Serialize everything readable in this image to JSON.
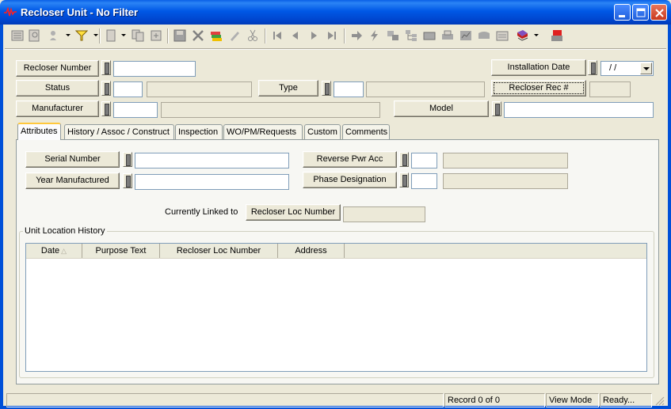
{
  "window": {
    "title": "Recloser Unit - No Filter"
  },
  "header": {
    "recloser_number_label": "Recloser Number",
    "recloser_number_value": "",
    "installation_date_label": "Installation Date",
    "installation_date_value": "/ /",
    "status_label": "Status",
    "status_code": "",
    "status_desc": "",
    "type_label": "Type",
    "type_code": "",
    "type_desc": "",
    "recloser_rec_label": "Recloser Rec #",
    "recloser_rec_value": "",
    "manufacturer_label": "Manufacturer",
    "manufacturer_code": "",
    "manufacturer_desc": "",
    "model_label": "Model",
    "model_value": ""
  },
  "tabs": [
    {
      "label": "Attributes",
      "active": true
    },
    {
      "label": "History / Assoc / Construct"
    },
    {
      "label": "Inspection"
    },
    {
      "label": "WO/PM/Requests"
    },
    {
      "label": "Custom"
    },
    {
      "label": "Comments"
    }
  ],
  "attributes": {
    "serial_number_label": "Serial Number",
    "serial_number_value": "",
    "year_manufactured_label": "Year Manufactured",
    "year_manufactured_value": "",
    "reverse_pwr_acc_label": "Reverse Pwr Acc",
    "phase_designation_label": "Phase Designation",
    "currently_linked_label": "Currently Linked to",
    "recloser_loc_number_label": "Recloser Loc Number",
    "recloser_loc_number_value": ""
  },
  "location_history": {
    "group_label": "Unit Location History",
    "columns": [
      "Date",
      "Purpose Text",
      "Recloser Loc Number",
      "Address"
    ],
    "rows": []
  },
  "status_bar": {
    "record": "Record 0 of 0",
    "mode": "View Mode",
    "state": "Ready..."
  },
  "toolbar_icons": [
    "list-icon",
    "search-form-icon",
    "user-tools-icon",
    "filter-icon",
    "document-icon",
    "copy-icon",
    "duplicate-icon",
    "save-icon",
    "delete-icon",
    "attach-icon",
    "edit-icon",
    "cut-icon",
    "first-record-icon",
    "prev-record-icon",
    "next-record-icon",
    "last-record-icon",
    "goto-icon",
    "lightning-icon",
    "link-icon",
    "tree-icon",
    "grid-icon",
    "print-icon",
    "report-icon",
    "folder-icon",
    "calendar-icon",
    "book-icon",
    "exit-icon"
  ]
}
